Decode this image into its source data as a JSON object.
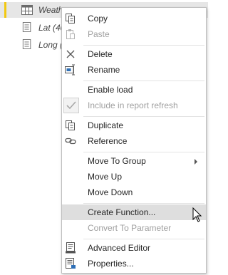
{
  "queries": [
    {
      "label": "Weath",
      "icon": "table-icon",
      "selected": true
    },
    {
      "label": "Lat (40",
      "icon": "parameter-icon",
      "selected": false
    },
    {
      "label": "Long (",
      "icon": "parameter-icon",
      "selected": false
    }
  ],
  "accent_color": "#f2c811",
  "menu": {
    "copy": "Copy",
    "paste": "Paste",
    "delete": "Delete",
    "rename": "Rename",
    "enable_load": "Enable load",
    "include_in_report_refresh": "Include in report refresh",
    "duplicate": "Duplicate",
    "reference": "Reference",
    "move_to_group": "Move To Group",
    "move_up": "Move Up",
    "move_down": "Move Down",
    "create_function": "Create Function...",
    "convert_to_parameter": "Convert To Parameter",
    "advanced_editor": "Advanced Editor",
    "properties": "Properties..."
  }
}
